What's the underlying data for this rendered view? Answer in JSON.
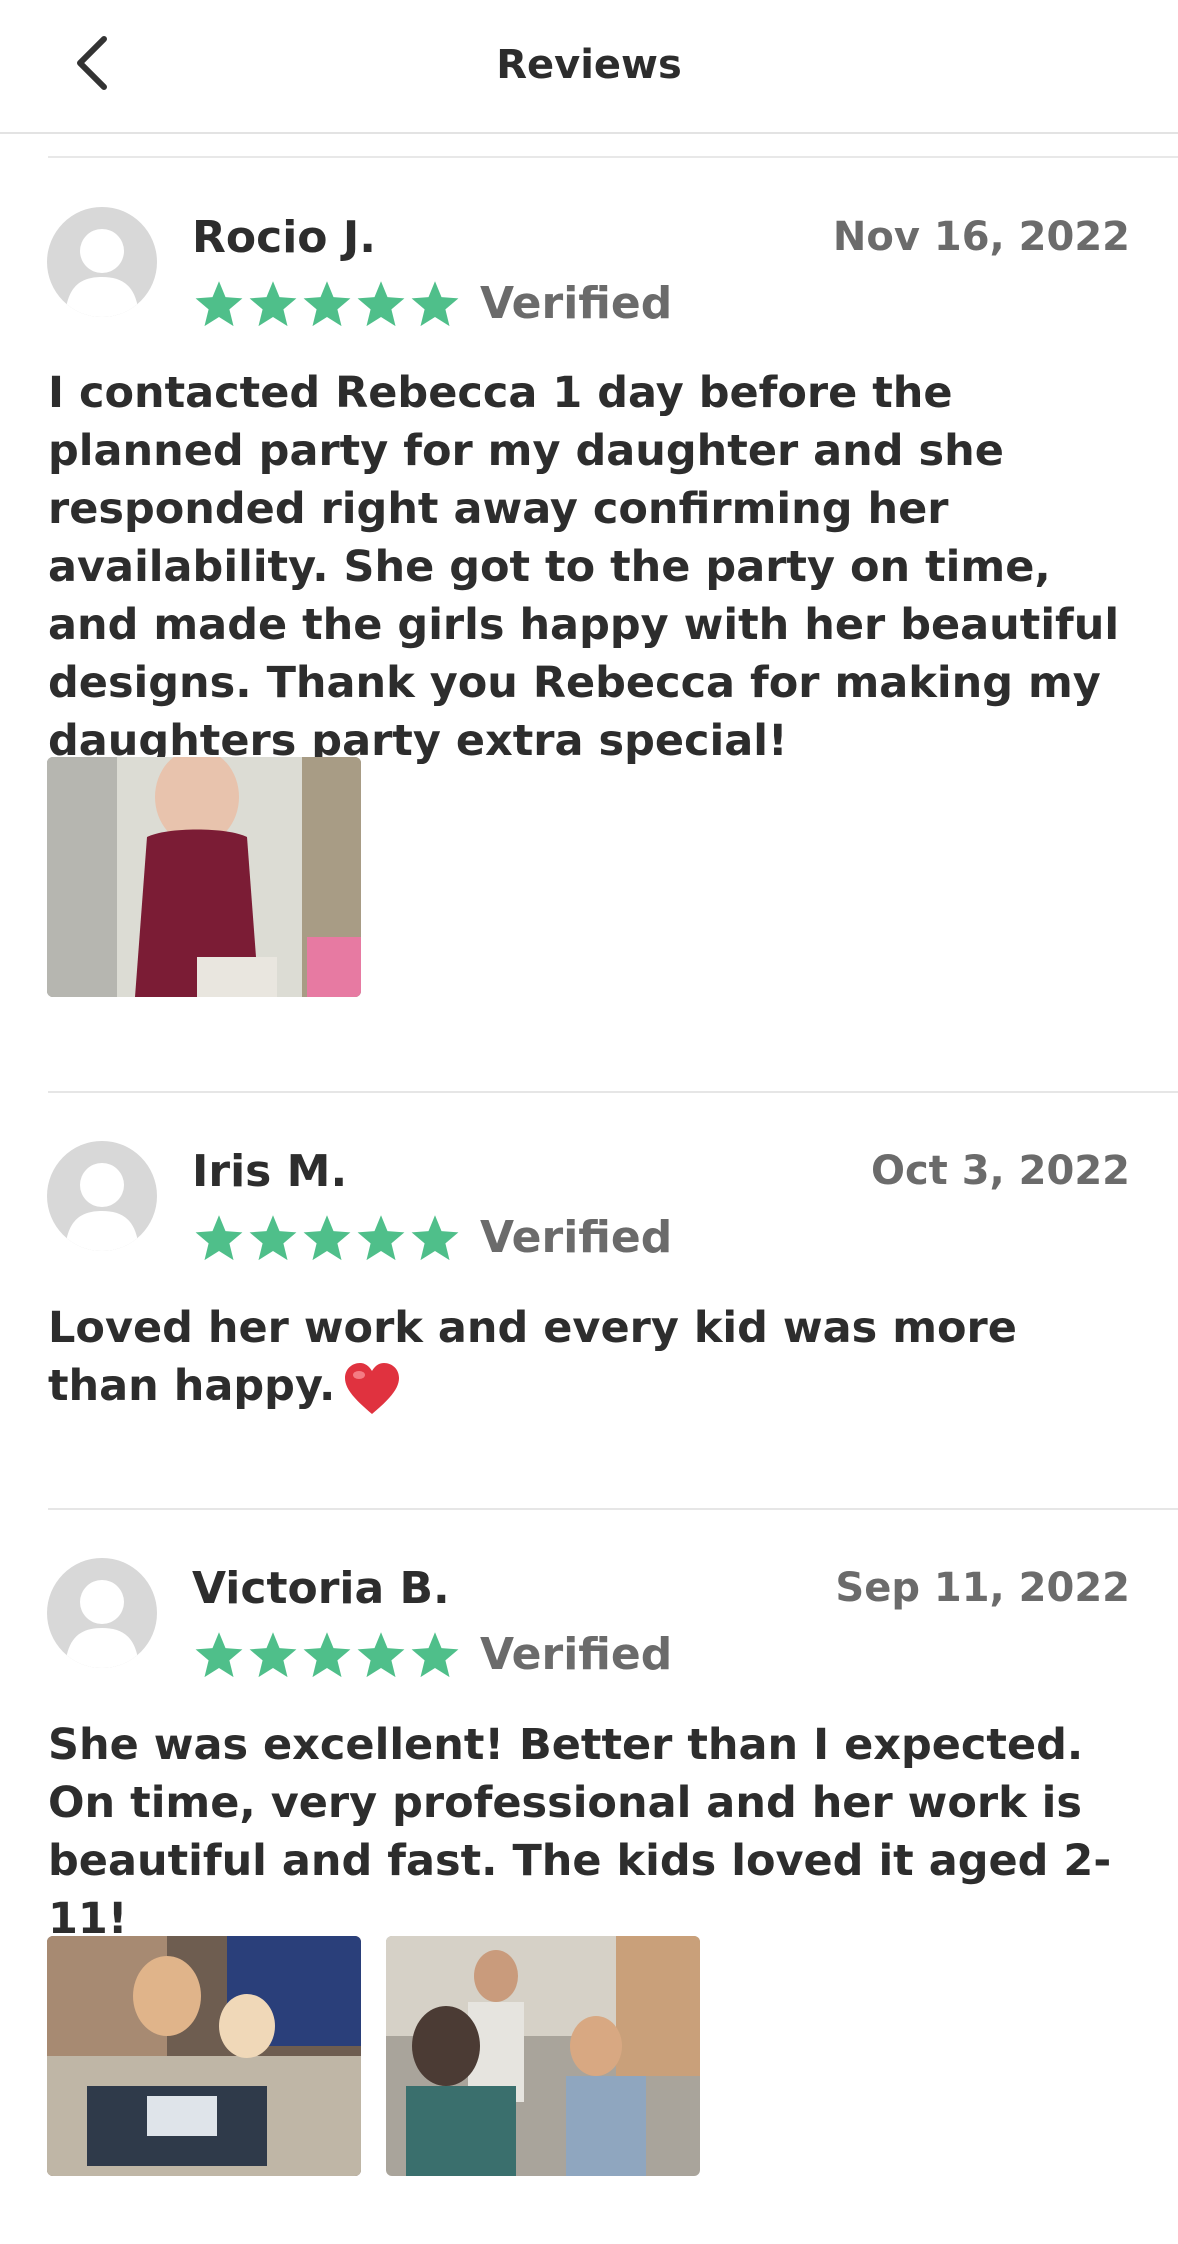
{
  "header": {
    "title": "Reviews",
    "back_icon": "chevron-left-icon"
  },
  "colors": {
    "star": "#4fbf8a",
    "text": "#2d2d2d",
    "muted": "#6b6b6b"
  },
  "reviews": [
    {
      "name": "Rocio J.",
      "date": "Nov 16, 2022",
      "rating": 5,
      "verified": "Verified",
      "text": "I contacted Rebecca 1 day before the planned party for my daughter and she responded right away confirming her availability.  She got to the party on time, and made the girls happy with her beautiful designs. Thank you Rebecca for making my daughters party extra special!",
      "photo_count": 1
    },
    {
      "name": "Iris M.",
      "date": "Oct 3, 2022",
      "rating": 5,
      "verified": "Verified",
      "text": "Loved her work and every kid was more than happy.",
      "emoji": "heart-emoji",
      "photo_count": 0
    },
    {
      "name": "Victoria B.",
      "date": "Sep 11, 2022",
      "rating": 5,
      "verified": "Verified",
      "text": "She was excellent! Better than I expected. On time, very professional and her work is beautiful and fast. The kids loved it aged 2-11!",
      "photo_count": 2
    }
  ]
}
